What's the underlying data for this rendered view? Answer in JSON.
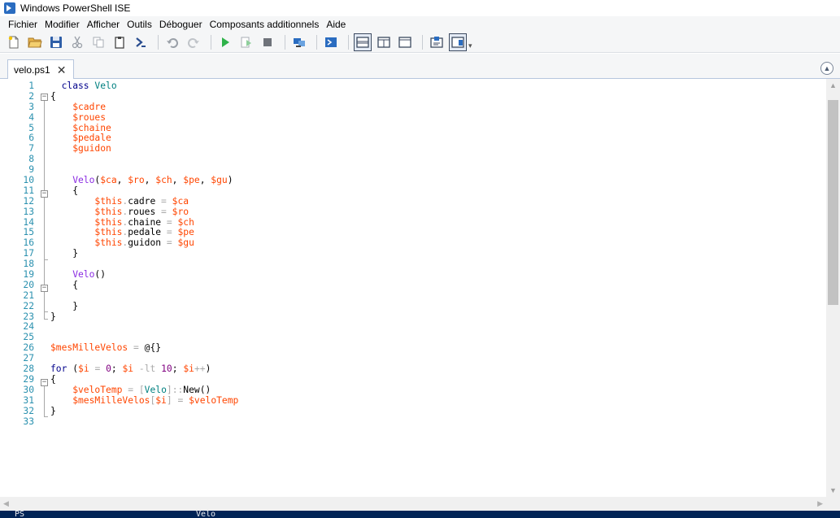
{
  "window": {
    "title": "Windows PowerShell ISE"
  },
  "menu": [
    "Fichier",
    "Modifier",
    "Afficher",
    "Outils",
    "Déboguer",
    "Composants additionnels",
    "Aide"
  ],
  "toolbar": {
    "icons": [
      "new-file-icon",
      "open-folder-icon",
      "save-icon",
      "cut-icon",
      "copy-icon",
      "paste-icon",
      "powershell-prompt-icon",
      "undo-icon",
      "redo-icon",
      "run-icon",
      "run-selection-icon",
      "stop-icon",
      "remote-session-icon",
      "powershell-console-icon",
      "layout-top-icon",
      "layout-right-icon",
      "layout-max-icon",
      "show-commands-icon",
      "addon-pane-icon"
    ],
    "dropdown": "▾"
  },
  "tab": {
    "label": "velo.ps1",
    "close": "✕"
  },
  "editor": {
    "line_numbers": [
      "1",
      "2",
      "3",
      "4",
      "5",
      "6",
      "7",
      "8",
      "9",
      "10",
      "11",
      "12",
      "13",
      "14",
      "15",
      "16",
      "17",
      "18",
      "19",
      "20",
      "21",
      "22",
      "23",
      "24",
      "25",
      "26",
      "27",
      "28",
      "29",
      "30",
      "31",
      "32",
      "33"
    ],
    "code": [
      [
        [
          "kw",
          "  class "
        ],
        [
          "ty",
          "Velo"
        ]
      ],
      [
        [
          "pl",
          "{"
        ]
      ],
      [
        [
          "var",
          "    $cadre"
        ]
      ],
      [
        [
          "var",
          "    $roues"
        ]
      ],
      [
        [
          "var",
          "    $chaine"
        ]
      ],
      [
        [
          "var",
          "    $pedale"
        ]
      ],
      [
        [
          "var",
          "    $guidon"
        ]
      ],
      [],
      [],
      [
        [
          "fn",
          "    Velo"
        ],
        [
          "pl",
          "("
        ],
        [
          "var",
          "$ca"
        ],
        [
          "pl",
          ", "
        ],
        [
          "var",
          "$ro"
        ],
        [
          "pl",
          ", "
        ],
        [
          "var",
          "$ch"
        ],
        [
          "pl",
          ", "
        ],
        [
          "var",
          "$pe"
        ],
        [
          "pl",
          ", "
        ],
        [
          "var",
          "$gu"
        ],
        [
          "pl",
          ")"
        ]
      ],
      [
        [
          "pl",
          "    {"
        ]
      ],
      [
        [
          "var",
          "        $this"
        ],
        [
          "op",
          "."
        ],
        [
          "pl",
          "cadre "
        ],
        [
          "op",
          "="
        ],
        [
          "pl",
          " "
        ],
        [
          "var",
          "$ca"
        ]
      ],
      [
        [
          "var",
          "        $this"
        ],
        [
          "op",
          "."
        ],
        [
          "pl",
          "roues "
        ],
        [
          "op",
          "="
        ],
        [
          "pl",
          " "
        ],
        [
          "var",
          "$ro"
        ]
      ],
      [
        [
          "var",
          "        $this"
        ],
        [
          "op",
          "."
        ],
        [
          "pl",
          "chaine "
        ],
        [
          "op",
          "="
        ],
        [
          "pl",
          " "
        ],
        [
          "var",
          "$ch"
        ]
      ],
      [
        [
          "var",
          "        $this"
        ],
        [
          "op",
          "."
        ],
        [
          "pl",
          "pedale "
        ],
        [
          "op",
          "="
        ],
        [
          "pl",
          " "
        ],
        [
          "var",
          "$pe"
        ]
      ],
      [
        [
          "var",
          "        $this"
        ],
        [
          "op",
          "."
        ],
        [
          "pl",
          "guidon "
        ],
        [
          "op",
          "="
        ],
        [
          "pl",
          " "
        ],
        [
          "var",
          "$gu"
        ]
      ],
      [
        [
          "pl",
          "    }"
        ]
      ],
      [],
      [
        [
          "fn",
          "    Velo"
        ],
        [
          "pl",
          "()"
        ]
      ],
      [
        [
          "pl",
          "    {"
        ]
      ],
      [],
      [
        [
          "pl",
          "    }"
        ]
      ],
      [
        [
          "pl",
          "}"
        ]
      ],
      [],
      [],
      [
        [
          "var",
          "$mesMilleVelos"
        ],
        [
          "pl",
          " "
        ],
        [
          "op",
          "="
        ],
        [
          "pl",
          " @{}"
        ]
      ],
      [],
      [
        [
          "kw",
          "for"
        ],
        [
          "pl",
          " ("
        ],
        [
          "var",
          "$i"
        ],
        [
          "pl",
          " "
        ],
        [
          "op",
          "="
        ],
        [
          "pl",
          " "
        ],
        [
          "num",
          "0"
        ],
        [
          "pl",
          "; "
        ],
        [
          "var",
          "$i"
        ],
        [
          "pl",
          " "
        ],
        [
          "op",
          "-lt"
        ],
        [
          "pl",
          " "
        ],
        [
          "num",
          "10"
        ],
        [
          "pl",
          "; "
        ],
        [
          "var",
          "$i"
        ],
        [
          "op",
          "++"
        ],
        [
          "pl",
          ")"
        ]
      ],
      [
        [
          "pl",
          "{"
        ]
      ],
      [
        [
          "var",
          "    $veloTemp"
        ],
        [
          "pl",
          " "
        ],
        [
          "op",
          "="
        ],
        [
          "pl",
          " "
        ],
        [
          "op",
          "["
        ],
        [
          "ty",
          "Velo"
        ],
        [
          "op",
          "]::"
        ],
        [
          "pl",
          "New()"
        ]
      ],
      [
        [
          "var",
          "    $mesMilleVelos"
        ],
        [
          "op",
          "["
        ],
        [
          "var",
          "$i"
        ],
        [
          "op",
          "]"
        ],
        [
          "pl",
          " "
        ],
        [
          "op",
          "="
        ],
        [
          "pl",
          " "
        ],
        [
          "var",
          "$veloTemp"
        ]
      ],
      [
        [
          "pl",
          "}"
        ]
      ],
      []
    ]
  },
  "scrollbars": {
    "up": "▲",
    "down": "▼",
    "left": "◀",
    "right": "▶",
    "collapse": "▲"
  },
  "console": {
    "prompt": "PS",
    "text": "Velo"
  },
  "colors": {
    "console_bg": "#012456",
    "line_number": "#2b91af",
    "variable": "#ff4500",
    "keyword": "#00008b",
    "type": "#008080",
    "function": "#8a2be2"
  }
}
